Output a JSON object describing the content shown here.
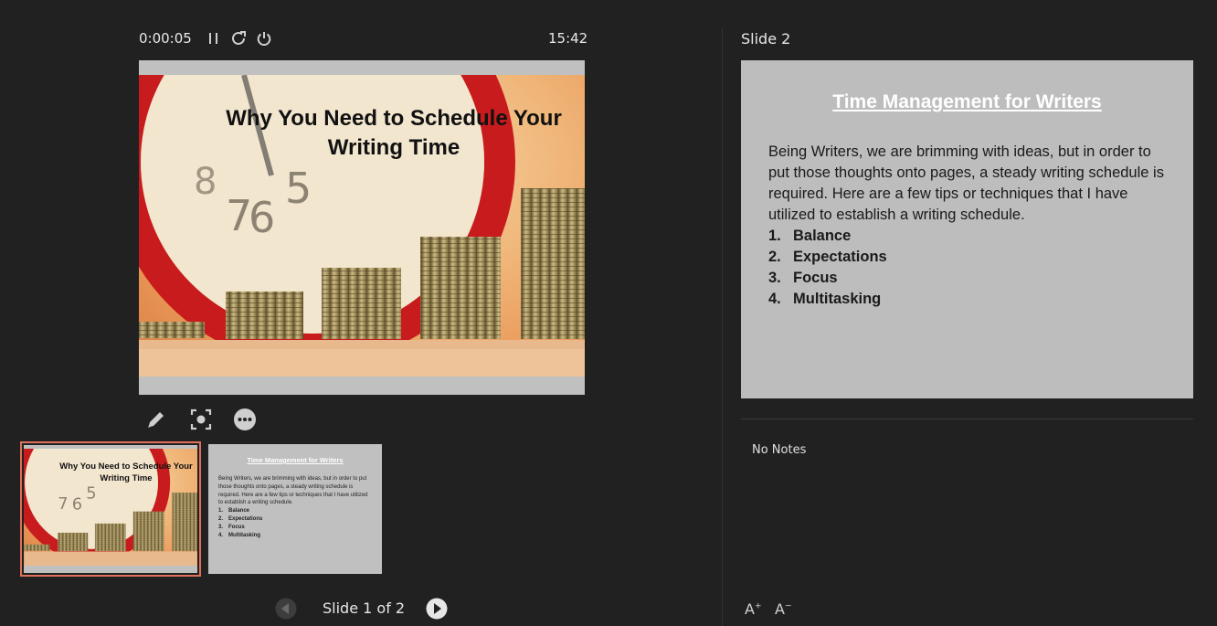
{
  "presenter": {
    "elapsed": "0:00:05",
    "clock": "15:42",
    "controls": {
      "pause": "pause-icon",
      "restart": "restart-icon",
      "end": "power-icon"
    }
  },
  "current_slide": {
    "title": "Why You Need to Schedule Your Writing Time",
    "background": "clock-and-coin-stacks-photo"
  },
  "tools": [
    "pen-icon",
    "zoom-icon",
    "more-icon"
  ],
  "thumbnails": [
    {
      "title": "Why You Need to Schedule Your Writing Time"
    },
    {
      "title": "Time Management for Writers",
      "body": "Being Writers, we are brimming with ideas, but in order to put those thoughts onto pages, a steady writing schedule is required. Here are a few tips or techniques that I have utilized to establish a writing schedule.",
      "items": [
        {
          "n": "1.",
          "text": "Balance"
        },
        {
          "n": "2.",
          "text": "Expectations"
        },
        {
          "n": "3.",
          "text": "Focus"
        },
        {
          "n": "4.",
          "text": "Multitasking"
        }
      ]
    }
  ],
  "pager": {
    "label": "Slide 1 of 2"
  },
  "next": {
    "label": "Slide 2",
    "title": "Time Management for Writers",
    "body": "Being Writers, we are brimming with ideas, but in order to put those thoughts onto pages, a steady writing schedule is required. Here are a few tips or techniques that I have utilized to establish a writing schedule.",
    "items": [
      {
        "n": "1.",
        "text": "Balance"
      },
      {
        "n": "2.",
        "text": "Expectations"
      },
      {
        "n": "3.",
        "text": "Focus"
      },
      {
        "n": "4.",
        "text": "Multitasking"
      }
    ]
  },
  "notes": {
    "text": "No Notes"
  },
  "font_controls": {
    "increase": "A",
    "decrease": "A"
  },
  "colors": {
    "background": "#212121",
    "thumb_selected": "#e0705a",
    "slide_grey": "#bdbdbd"
  }
}
